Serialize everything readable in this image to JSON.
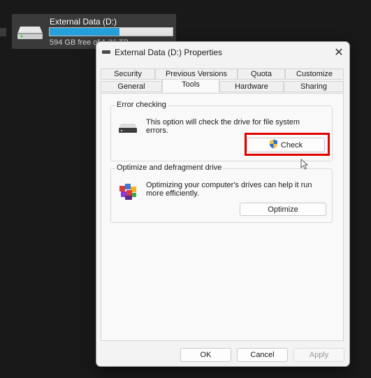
{
  "explorer": {
    "drive_name": "External Data (D:)",
    "free_space": "594 GB free of 1.36 TB",
    "usage_fraction": 0.57,
    "bar_color": "#26a0da"
  },
  "dialog": {
    "title": "External Data (D:) Properties",
    "close_glyph": "✕",
    "tabs_row1": [
      "Security",
      "Previous Versions",
      "Quota",
      "Customize"
    ],
    "tabs_row2": [
      "General",
      "Tools",
      "Hardware",
      "Sharing"
    ],
    "active_tab": "Tools",
    "error_checking": {
      "label": "Error checking",
      "description": "This option will check the drive for file system errors.",
      "button": "Check",
      "icon": "drive-icon",
      "button_icon": "uac-shield-icon"
    },
    "optimize": {
      "label": "Optimize and defragment drive",
      "description": "Optimizing your computer's drives can help it run more efficiently.",
      "button": "Optimize",
      "icon": "defrag-icon"
    },
    "footer": {
      "ok": "OK",
      "cancel": "Cancel",
      "apply": "Apply"
    }
  },
  "colors": {
    "highlight": "#e00000",
    "background": "#191919"
  }
}
